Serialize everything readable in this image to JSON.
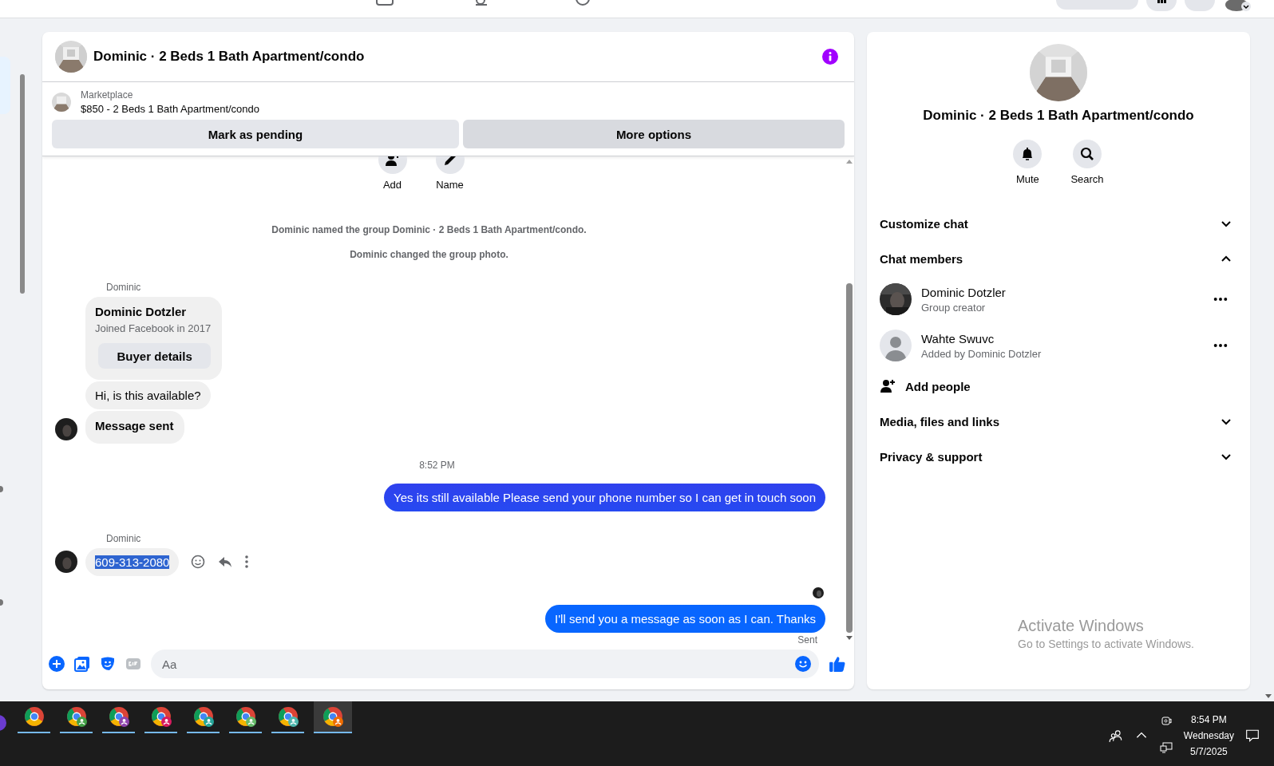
{
  "chat": {
    "title": "Dominic · 2 Beds 1 Bath Apartment/condo",
    "listing": {
      "source": "Marketplace",
      "text": "$850 - 2 Beds 1 Bath Apartment/condo"
    },
    "actions": [
      {
        "label": "Mark as pending"
      },
      {
        "label": "More options"
      }
    ],
    "quick_actions": [
      {
        "label": "Add",
        "kind": "add"
      },
      {
        "label": "Name",
        "kind": "edit"
      }
    ],
    "messages": [
      {
        "kind": "event",
        "text": "Dominic named the group Dominic · 2 Beds 1 Bath Apartment/condo."
      },
      {
        "kind": "event",
        "text": "Dominic changed the group photo."
      },
      {
        "kind": "sender",
        "text": "Dominic"
      },
      {
        "kind": "card",
        "name": "Dominic Dotzler",
        "subtitle": "Joined Facebook in 2017",
        "button": "Buyer details"
      },
      {
        "kind": "incoming",
        "text": "Hi, is this available?",
        "avatar": false,
        "bold": false,
        "highlighted": false
      },
      {
        "kind": "incoming",
        "text": "Message sent",
        "avatar": true,
        "bold": true,
        "highlighted": false
      },
      {
        "kind": "time",
        "text": "8:52 PM"
      },
      {
        "kind": "outgoing",
        "text": "Yes its still available Please send your phone number so I can get in touch soon"
      },
      {
        "kind": "sender",
        "text": "Dominic"
      },
      {
        "kind": "incoming",
        "text": "609-313-2080",
        "avatar": true,
        "bold": false,
        "highlighted": true,
        "hover_actions": true
      },
      {
        "kind": "seen"
      },
      {
        "kind": "outgoing",
        "text": "I'll send you a message as soon as I can. Thanks"
      },
      {
        "kind": "status",
        "text": "Sent"
      }
    ],
    "composer": {
      "placeholder": "Aa"
    }
  },
  "details": {
    "title": "Dominic · 2 Beds 1 Bath Apartment/condo",
    "actions": [
      {
        "label": "Mute",
        "kind": "bell"
      },
      {
        "label": "Search",
        "kind": "search"
      }
    ],
    "sections": [
      {
        "label": "Customize chat",
        "expanded": false
      },
      {
        "label": "Chat members",
        "expanded": true,
        "members": [
          {
            "name": "Dominic Dotzler",
            "role": "Group creator",
            "photo": true
          },
          {
            "name": "Wahte Swuvc",
            "role": "Added by Dominic Dotzler",
            "photo": false
          }
        ],
        "add": "Add people"
      },
      {
        "label": "Media, files and links",
        "expanded": false
      },
      {
        "label": "Privacy & support",
        "expanded": false
      }
    ]
  },
  "activation_notice": {
    "title": "Activate Windows",
    "text": "Go to Settings to activate Windows."
  },
  "taskbar": {
    "apps": [
      {
        "kind": "chrome",
        "selected": false
      },
      {
        "kind": "chrome-profile",
        "color": "#43a047",
        "selected": false
      },
      {
        "kind": "chrome-profile",
        "color": "#8e44ad",
        "selected": false
      },
      {
        "kind": "chrome-profile",
        "color": "#d81b60",
        "selected": false
      },
      {
        "kind": "chrome-profile",
        "color": "#26a69a",
        "selected": false
      },
      {
        "kind": "chrome-profile",
        "color": "#66bb6a",
        "selected": false
      },
      {
        "kind": "chrome-profile",
        "color": "#4db6ac",
        "selected": false
      },
      {
        "kind": "chrome-profile",
        "color": "#ef6c00",
        "selected": true
      }
    ],
    "time": "8:54 PM",
    "day": "Wednesday",
    "date": "5/7/2025"
  }
}
